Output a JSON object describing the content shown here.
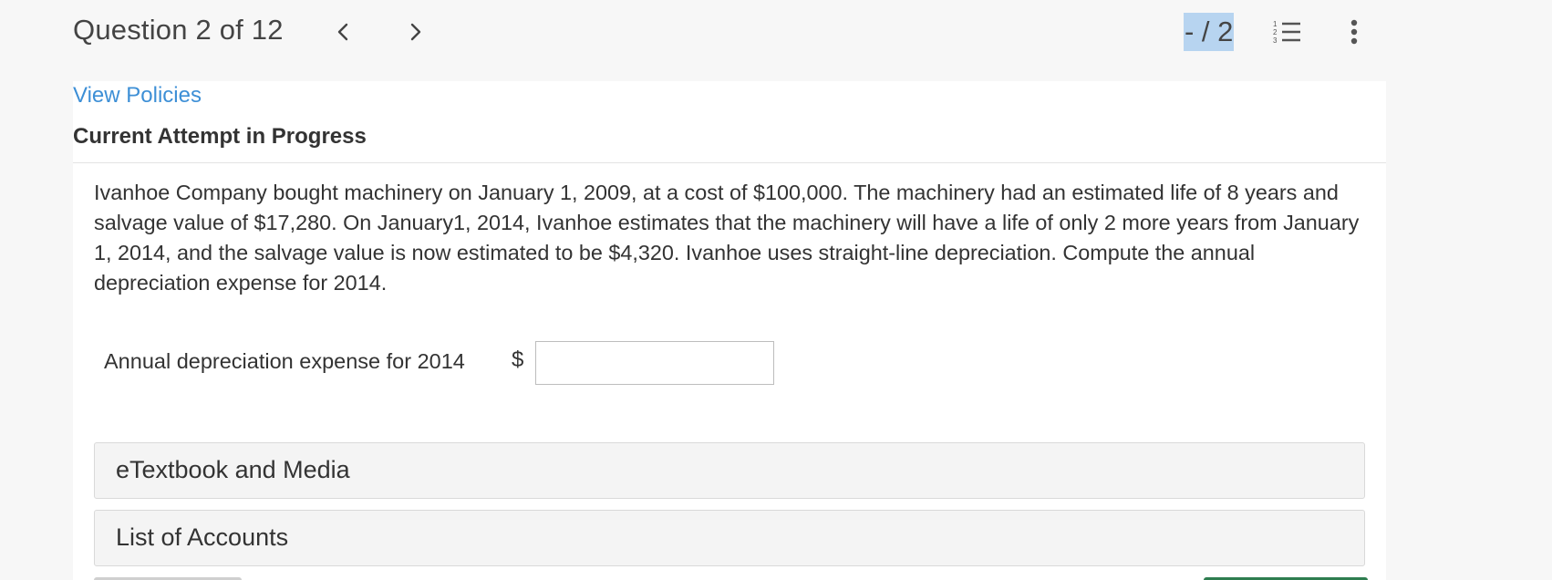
{
  "header": {
    "question_title": "Question 2 of 12",
    "score": "- / 2",
    "icons": {
      "prev": "chevron-left-icon",
      "next": "chevron-right-icon",
      "list": "numbered-list-icon",
      "more": "more-vertical-icon"
    }
  },
  "content": {
    "policies_link": "View Policies",
    "attempt_heading": "Current Attempt in Progress",
    "question_text": "Ivanhoe Company bought machinery on January 1, 2009, at a cost of $100,000. The machinery had an estimated life of 8 years and salvage value of $17,280. On January1, 2014, Ivanhoe estimates that the machinery will have a life of only 2 more years from January 1, 2014, and the salvage value is now estimated to be $4,320. Ivanhoe uses straight-line depreciation. Compute the annual depreciation expense for 2014.",
    "answer_label": "Annual depreciation expense for 2014",
    "currency_symbol": "$",
    "answer_value": ""
  },
  "resources": {
    "etextbook_label": "eTextbook and Media",
    "accounts_label": "List of Accounts"
  },
  "colors": {
    "link": "#3d8fd6",
    "score_highlight": "#b7d4f0",
    "submit_accent": "#2e7d4f"
  }
}
